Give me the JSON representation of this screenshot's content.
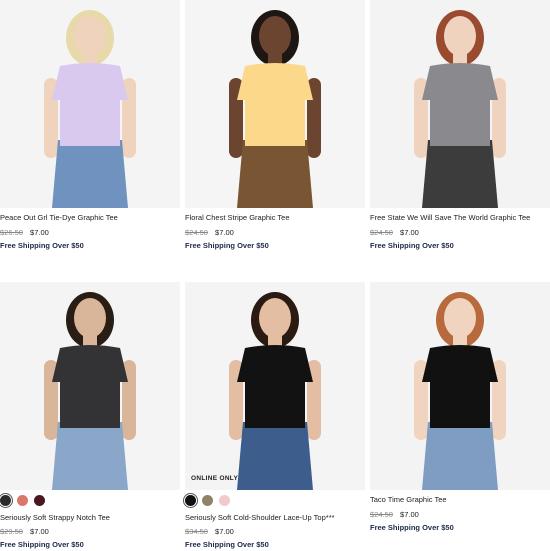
{
  "products": [
    {
      "title": "Peace Out Grl Tie-Dye Graphic Tee",
      "old_price": "$26.50",
      "new_price": "$7.00",
      "shipping": "Free Shipping Over $50",
      "colors": {
        "bg": "#f4f4f4",
        "shirt": "#d9c9ef",
        "bottom": "#6f93be",
        "hair": "#e7d9a9",
        "skin": "#efd3bd"
      }
    },
    {
      "title": "Floral Chest Stripe Graphic Tee",
      "old_price": "$24.50",
      "new_price": "$7.00",
      "shipping": "Free Shipping Over $50",
      "colors": {
        "bg": "#f5f5f5",
        "shirt": "#fbd88a",
        "bottom": "#7a5533",
        "hair": "#1e1612",
        "skin": "#6b4530"
      }
    },
    {
      "title": "Free State We Will Save The World Graphic Tee",
      "old_price": "$24.50",
      "new_price": "$7.00",
      "shipping": "Free Shipping Over $50",
      "colors": {
        "bg": "#f3f3f3",
        "shirt": "#8a8a8e",
        "bottom": "#3c3c3c",
        "hair": "#9a4a2e",
        "skin": "#f0d3bf"
      }
    },
    {
      "title": "Seriously Soft Strappy Notch Tee",
      "old_price": "$29.50",
      "new_price": "$7.00",
      "shipping": "Free Shipping Over $50",
      "swatches": [
        "#2b2b2b",
        "#d9776b",
        "#4a1620"
      ],
      "colors": {
        "bg": "#f4f4f4",
        "shirt": "#333336",
        "bottom": "#8aa6c9",
        "hair": "#2a1d16",
        "skin": "#d9b59a"
      }
    },
    {
      "title": "Seriously Soft Cold-Shoulder Lace-Up Top***",
      "old_price": "$34.50",
      "new_price": "$7.00",
      "shipping": "Free Shipping Over $50",
      "badge": "ONLINE ONLY",
      "swatches": [
        "#111111",
        "#8f8465",
        "#f2c9cc"
      ],
      "colors": {
        "bg": "#f4f4f4",
        "shirt": "#121212",
        "bottom": "#3d5e8c",
        "hair": "#2a1a12",
        "skin": "#e3bea2"
      }
    },
    {
      "title": "Taco Time Graphic Tee",
      "old_price": "$24.50",
      "new_price": "$7.00",
      "shipping": "Free Shipping Over $50",
      "colors": {
        "bg": "#f3f3f3",
        "shirt": "#111111",
        "bottom": "#7f9cc3",
        "hair": "#b86a3c",
        "skin": "#f0d4c0"
      }
    }
  ]
}
